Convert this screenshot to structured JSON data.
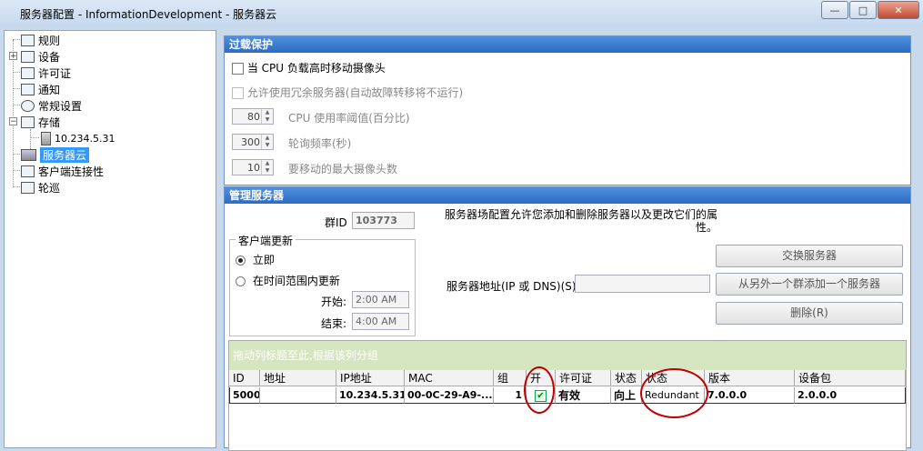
{
  "window": {
    "title": "服务器配置 - InformationDevelopment - 服务器云",
    "minimize": "—",
    "maximize": "□",
    "close": "✕"
  },
  "tree": {
    "items": [
      {
        "label": "规则",
        "icon": "document-icon"
      },
      {
        "label": "设备",
        "icon": "network-icon"
      },
      {
        "label": "许可证",
        "icon": "certificate-icon"
      },
      {
        "label": "通知",
        "icon": "document-icon"
      },
      {
        "label": "常规设置",
        "icon": "gear-icon"
      },
      {
        "label": "存储",
        "icon": "drive-icon"
      },
      {
        "label": "10.234.5.31",
        "icon": "server-icon"
      },
      {
        "label": "服务器云",
        "icon": "cloud-server-icon"
      },
      {
        "label": "客户端连接性",
        "icon": "drive-icon"
      },
      {
        "label": "轮巡",
        "icon": "monitor-icon"
      }
    ]
  },
  "overload": {
    "header": "过载保护",
    "move_cameras_label": "当 CPU 负载高时移动摄像头",
    "redundant_label": "允许使用冗余服务器(自动故障转移将不运行)",
    "cpu_threshold": {
      "value": "80",
      "label": "CPU 使用率阈值(百分比)"
    },
    "poll_freq": {
      "value": "300",
      "label": "轮询频率(秒)"
    },
    "max_cameras": {
      "value": "10",
      "label": "要移动的最大摄像头数"
    }
  },
  "manage": {
    "header": "管理服务器",
    "group_id_label": "群ID",
    "group_id_value": "103773",
    "description": "服务器场配置允许您添加和删除服务器以及更改它们的属性。",
    "client_update_title": "客户端更新",
    "immediate_label": "立即",
    "time_range_label": "在时间范围内更新",
    "start_label": "开始:",
    "start_value": "2:00 AM",
    "end_label": "结束:",
    "end_value": "4:00 AM",
    "server_address_label": "服务器地址(IP 或 DNS)(S)",
    "server_address_value": "",
    "exchange_button": "交换服务器",
    "add_from_group_button": "从另外一个群添加一个服务器",
    "delete_button": "删除(R)",
    "group_by_hint": "拖动列标题至此,根据该列分组",
    "columns": [
      "ID",
      "地址",
      "IP地址",
      "MAC",
      "组",
      "开",
      "许可证",
      "状态",
      "状态",
      "版本",
      "设备包"
    ],
    "rows": [
      [
        "5000",
        "",
        "10.234.5.31",
        "00-0C-29-A9-...",
        "1",
        "✔",
        "有效",
        "向上",
        "Redundant",
        "7.0.0.0",
        "2.0.0.0"
      ]
    ]
  },
  "colors": {
    "header_blue": "#2b6bc2",
    "selection": "#3399ff",
    "annotation_red": "#c00000",
    "group_bar": "#d5e5c0"
  }
}
